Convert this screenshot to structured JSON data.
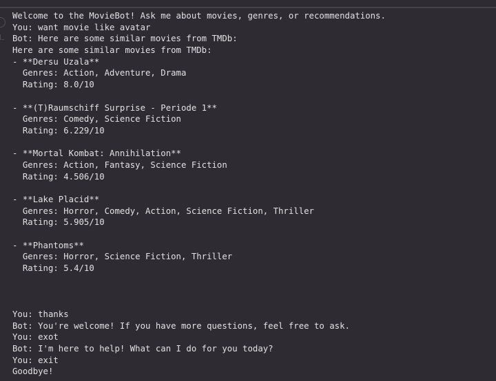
{
  "terminal": {
    "background_color": "#2e2b33",
    "text_color": "#e2e2e4",
    "lines": [
      "Welcome to the MovieBot! Ask me about movies, genres, or recommendations.",
      "You: want movie like avatar",
      "Bot: Here are some similar movies from TMDb:",
      "Here are some similar movies from TMDb:",
      "- **Dersu Uzala**",
      "  Genres: Action, Adventure, Drama",
      "  Rating: 8.0/10",
      "",
      "- **(T)Raumschiff Surprise - Periode 1**",
      "  Genres: Comedy, Science Fiction",
      "  Rating: 6.229/10",
      "",
      "- **Mortal Kombat: Annihilation**",
      "  Genres: Action, Fantasy, Science Fiction",
      "  Rating: 4.506/10",
      "",
      "- **Lake Placid**",
      "  Genres: Horror, Comedy, Action, Science Fiction, Thriller",
      "  Rating: 5.905/10",
      "",
      "- **Phantoms**",
      "  Genres: Horror, Science Fiction, Thriller",
      "  Rating: 5.4/10",
      "",
      "",
      "",
      "You: thanks",
      "Bot: You're welcome! If you have more questions, feel free to ask.",
      "You: exot",
      "Bot: I'm here to help! What can I do for you today?",
      "You: exit",
      "Goodbye!"
    ]
  },
  "conversation": {
    "greeting": "Welcome to the MovieBot! Ask me about movies, genres, or recommendations.",
    "exchanges": [
      {
        "speaker": "You",
        "text": "want movie like avatar"
      },
      {
        "speaker": "Bot",
        "text": "Here are some similar movies from TMDb:"
      },
      {
        "speaker": "You",
        "text": "thanks"
      },
      {
        "speaker": "Bot",
        "text": "You're welcome! If you have more questions, feel free to ask."
      },
      {
        "speaker": "You",
        "text": "exot"
      },
      {
        "speaker": "Bot",
        "text": "I'm here to help! What can I do for you today?"
      },
      {
        "speaker": "You",
        "text": "exit"
      }
    ],
    "farewell": "Goodbye!"
  },
  "results": {
    "header": "Here are some similar movies from TMDb:",
    "labels": {
      "genres": "Genres:",
      "rating": "Rating:",
      "bullet": "-"
    },
    "movies": [
      {
        "title": "Dersu Uzala",
        "genres": "Action, Adventure, Drama",
        "rating": "8.0/10"
      },
      {
        "title": "(T)Raumschiff Surprise - Periode 1",
        "genres": "Comedy, Science Fiction",
        "rating": "6.229/10"
      },
      {
        "title": "Mortal Kombat: Annihilation",
        "genres": "Action, Fantasy, Science Fiction",
        "rating": "4.506/10"
      },
      {
        "title": "Lake Placid",
        "genres": "Horror, Comedy, Action, Science Fiction, Thriller",
        "rating": "5.905/10"
      },
      {
        "title": "Phantoms",
        "genres": "Horror, Science Fiction, Thriller",
        "rating": "5.4/10"
      }
    ]
  }
}
